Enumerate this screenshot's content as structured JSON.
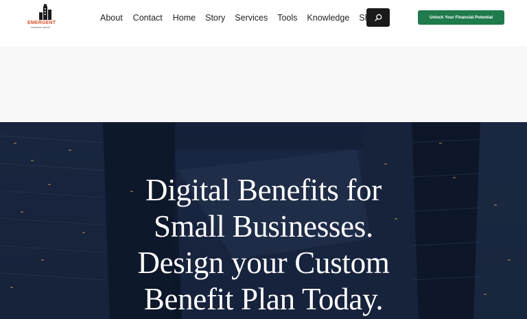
{
  "logo": {
    "text": "EMERGENT",
    "subtext": "FINANCIAL GROUP"
  },
  "nav": {
    "items": [
      {
        "label": "About"
      },
      {
        "label": "Contact"
      },
      {
        "label": "Home"
      },
      {
        "label": "Story"
      },
      {
        "label": "Services"
      },
      {
        "label": "Tools"
      },
      {
        "label": "Knowledge"
      },
      {
        "label": "Shop"
      }
    ]
  },
  "search": {
    "icon": "search-icon"
  },
  "cta": {
    "label": "Unlock Your Financial Potential"
  },
  "hero": {
    "lines": [
      "Digital Benefits for",
      "Small Businesses.",
      "Design your Custom",
      "Benefit Plan Today."
    ]
  },
  "colors": {
    "cta_bg": "#1f7a4c",
    "search_bg": "#1a1a1a",
    "hero_bg": "#121d33",
    "logo_accent": "#d9532b"
  }
}
